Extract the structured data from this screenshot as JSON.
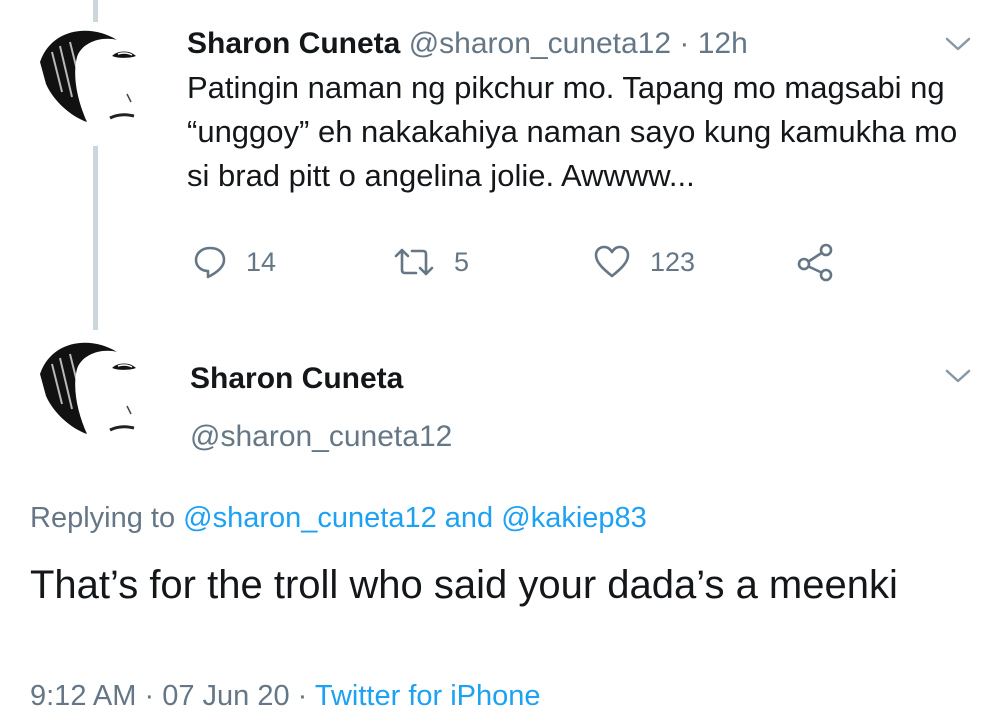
{
  "tweet1": {
    "author_name": "Sharon Cuneta",
    "handle": "@sharon_cuneta12",
    "separator": "·",
    "time": "12h",
    "text": "Patingin naman ng pikchur mo. Tapang mo magsabi ng “unggoy” eh nakakahiya naman sayo kung kamukha mo si brad pitt o angelina jolie. Awwww...",
    "actions": {
      "reply_icon": "reply-bubble-icon",
      "reply_count": "14",
      "retweet_icon": "retweet-icon",
      "retweet_count": "5",
      "like_icon": "heart-icon",
      "like_count": "123",
      "share_icon": "share-icon"
    }
  },
  "tweet2": {
    "author_name": "Sharon Cuneta",
    "handle": "@sharon_cuneta12",
    "replying_prefix": "Replying to",
    "replying_user1": "@sharon_cuneta12",
    "replying_and": "and",
    "replying_user2": "@kakiep83",
    "text": "That’s for the troll who said your dada’s a meenki",
    "time": "9:12 AM",
    "separator": "·",
    "date": "07 Jun 20",
    "source": "Twitter for iPhone"
  },
  "colors": {
    "text": "#14171a",
    "muted": "#657786",
    "link": "#1da1f2",
    "thread_line": "#ccd6dd"
  }
}
